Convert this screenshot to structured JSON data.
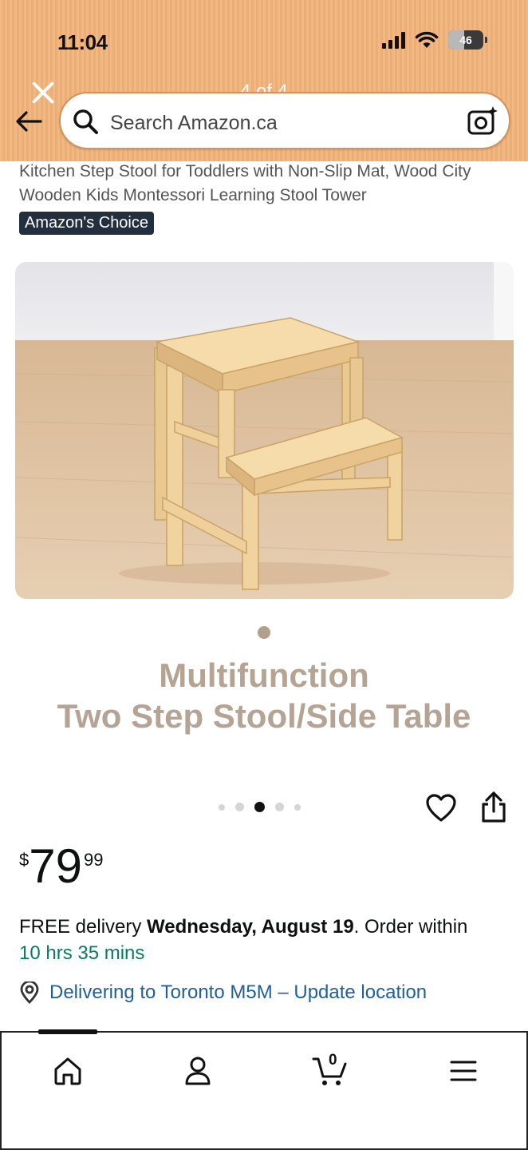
{
  "status_bar": {
    "time": "11:04",
    "battery": "46",
    "battery_level": 0.46
  },
  "header": {
    "page_indicator": "4 of 4",
    "search_placeholder": "Search Amazon.ca"
  },
  "product": {
    "title": "Kitchen Step Stool for Toddlers with Non-Slip Mat, Wood City Wooden Kids Montessori Learning Stool Tower",
    "badge": "Amazon's Choice",
    "feature_line1": "Multifunction",
    "feature_line2": "Two Step Stool/Side Table",
    "carousel": {
      "count": 5,
      "active_index": 2
    }
  },
  "price": {
    "currency": "$",
    "whole": "79",
    "fraction": "99"
  },
  "delivery": {
    "prefix": "FREE delivery ",
    "date": "Wednesday, August 19",
    "suffix": ". Order within",
    "countdown": "10 hrs 35 mins",
    "location": "Delivering to Toronto M5M – Update location"
  },
  "bottom_nav": {
    "items": [
      {
        "icon": "home-icon"
      },
      {
        "icon": "account-icon"
      },
      {
        "icon": "cart-icon",
        "count": "0"
      },
      {
        "icon": "menu-icon"
      }
    ]
  },
  "colors": {
    "header_bg": "#f2b47a",
    "badge_bg": "#232f3e",
    "countdown": "#067d62",
    "link": "#1f5f9a",
    "feature_text": "#b5a393"
  }
}
